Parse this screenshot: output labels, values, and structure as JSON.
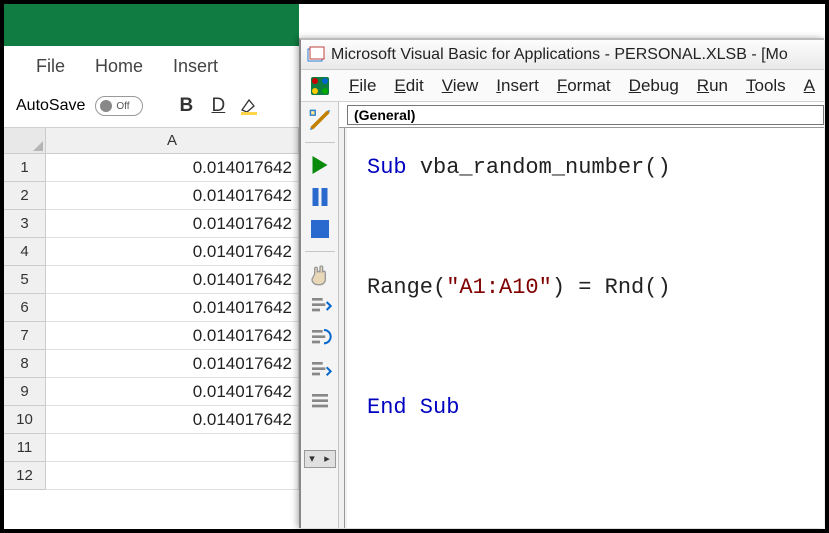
{
  "excel": {
    "ribbon": {
      "file": "File",
      "home": "Home",
      "insert": "Insert"
    },
    "toolbar": {
      "autosave_label": "AutoSave",
      "autosave_state": "Off",
      "bold": "B",
      "underline": "D"
    },
    "column_header": "A",
    "rows": [
      {
        "n": "1",
        "v": "0.014017642"
      },
      {
        "n": "2",
        "v": "0.014017642"
      },
      {
        "n": "3",
        "v": "0.014017642"
      },
      {
        "n": "4",
        "v": "0.014017642"
      },
      {
        "n": "5",
        "v": "0.014017642"
      },
      {
        "n": "6",
        "v": "0.014017642"
      },
      {
        "n": "7",
        "v": "0.014017642"
      },
      {
        "n": "8",
        "v": "0.014017642"
      },
      {
        "n": "9",
        "v": "0.014017642"
      },
      {
        "n": "10",
        "v": "0.014017642"
      },
      {
        "n": "11",
        "v": ""
      },
      {
        "n": "12",
        "v": ""
      }
    ]
  },
  "vba": {
    "title": "Microsoft Visual Basic for Applications - PERSONAL.XLSB - [Mo",
    "menu": {
      "file": "File",
      "edit": "Edit",
      "view": "View",
      "insert": "Insert",
      "format": "Format",
      "debug": "Debug",
      "run": "Run",
      "tools": "Tools",
      "addins": "A"
    },
    "proc": "(General)",
    "code": {
      "sub": "Sub",
      "subname": "vba_random_number",
      "range_fn": "Range",
      "range_arg": "\"A1:A10\"",
      "eq": " = ",
      "rnd": "Rnd",
      "end": "End Sub"
    }
  }
}
